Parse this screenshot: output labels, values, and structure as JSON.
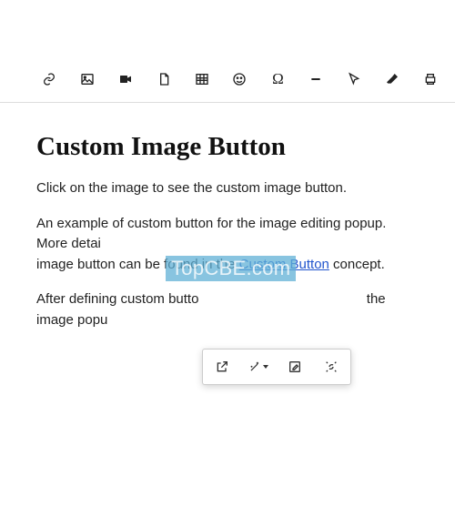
{
  "watermark": "TopCBE.com",
  "toolbar": {
    "icons": [
      "link",
      "image",
      "video",
      "file",
      "table",
      "smiley",
      "omega",
      "minus",
      "arrow",
      "eraser",
      "print"
    ]
  },
  "content": {
    "heading": "Custom Image Button",
    "p1": "Click on the image to see the custom image button.",
    "p2_a": "An example of custom button for the image editing popup. More detai",
    "p2_b": "image button can be found in the ",
    "p2_link": "Custom Button",
    "p2_c": " concept.",
    "p3_a": "After defining custom butto",
    "p3_b": "the image popu"
  },
  "popup": {
    "items": [
      "open-external",
      "magic-wand",
      "edit",
      "unlink"
    ]
  }
}
